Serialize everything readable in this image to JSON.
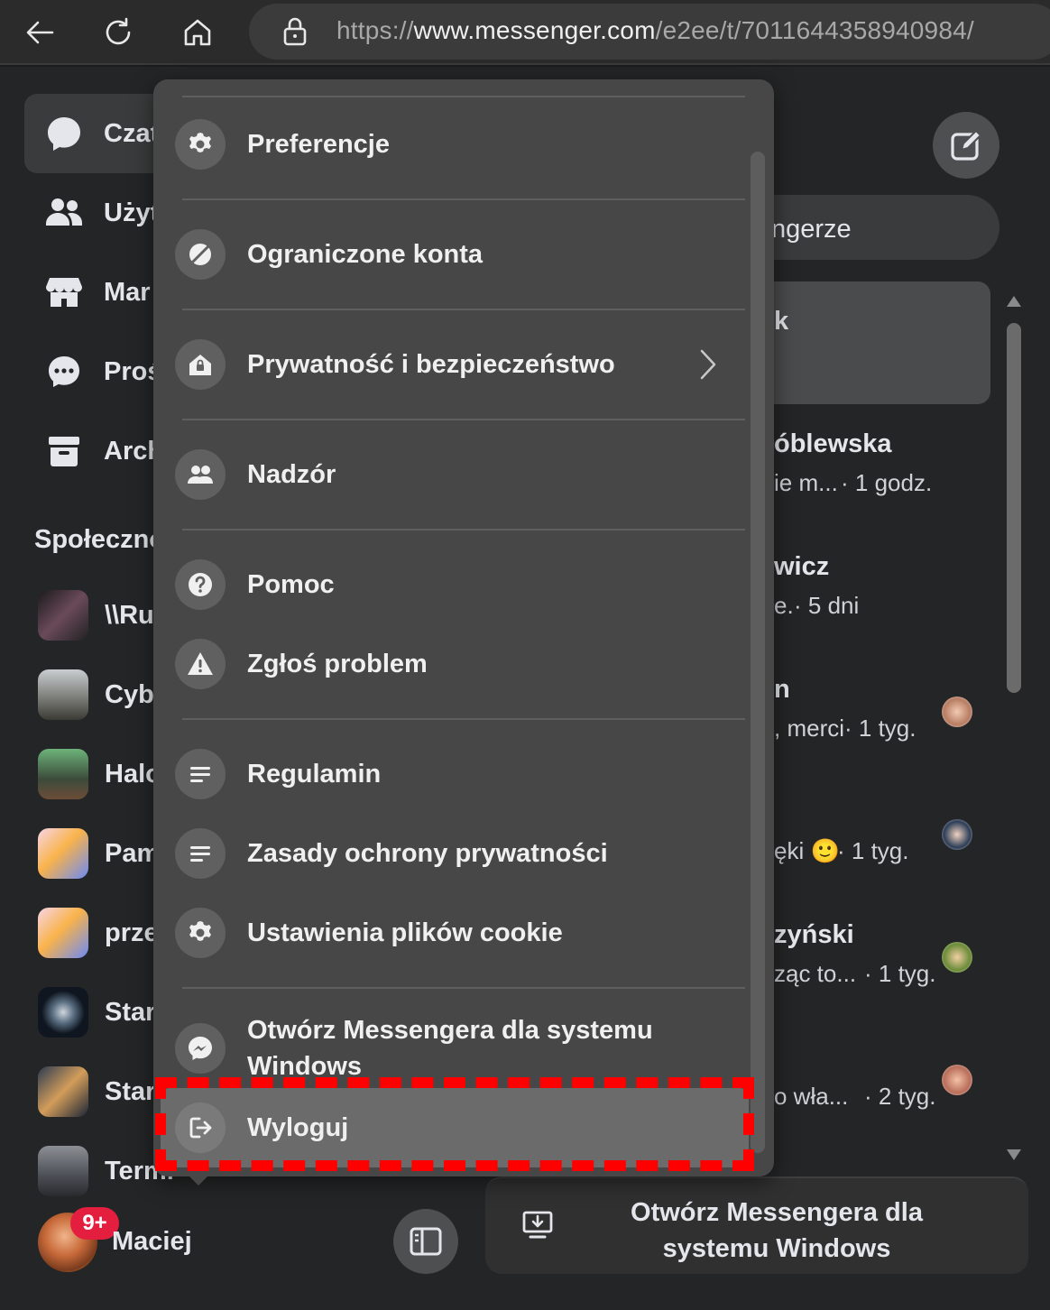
{
  "browser": {
    "url_prefix": "https://",
    "url_domain": "www.messenger.com",
    "url_path": "/e2ee/t/7011644358940984/"
  },
  "nav": {
    "items": [
      {
        "label": "Czat"
      },
      {
        "label": "Użyt"
      },
      {
        "label": "Mar"
      },
      {
        "label": "Proś"
      },
      {
        "label": "Arch"
      }
    ],
    "section_title": "Społeczno",
    "communities": [
      {
        "label": "\\\\Ru"
      },
      {
        "label": "Cybe"
      },
      {
        "label": "Halo"
      },
      {
        "label": "Pam"
      },
      {
        "label": "prze"
      },
      {
        "label": "Star"
      },
      {
        "label": "Star"
      },
      {
        "label": "Termi"
      }
    ]
  },
  "user": {
    "name": "Maciej",
    "badge": "9+"
  },
  "chat_panel": {
    "search_text": "ngerze",
    "highlight_name": "k",
    "chats": [
      {
        "name": "óblewska",
        "preview": "ie m...",
        "time": "· 1 godz."
      },
      {
        "name": "wicz",
        "preview": "e.",
        "time": "· 5 dni"
      },
      {
        "name": "n",
        "preview": ", merci",
        "time": "· 1 tyg."
      },
      {
        "name": "",
        "preview": "ęki 🙂",
        "time": "· 1 tyg."
      },
      {
        "name": "zyński",
        "preview": "ząc to...",
        "time": "· 1 tyg."
      },
      {
        "name": "",
        "preview": "o wła...",
        "time": "· 2 tyg."
      }
    ],
    "open_app_label": "Otwórz Messengera dla systemu Windows"
  },
  "menu": {
    "items": [
      {
        "label": "Preferencje",
        "icon": "gear-icon"
      },
      {
        "label": "Ograniczone konta",
        "icon": "restricted-icon"
      },
      {
        "label": "Prywatność i bezpieczeństwo",
        "icon": "privacy-home-icon"
      },
      {
        "label": "Nadzór",
        "icon": "supervision-icon"
      },
      {
        "label": "Pomoc",
        "icon": "help-icon"
      },
      {
        "label": "Zgłoś problem",
        "icon": "warning-icon"
      },
      {
        "label": "Regulamin",
        "icon": "document-lines-icon"
      },
      {
        "label": "Zasady ochrony prywatności",
        "icon": "document-lines-icon"
      },
      {
        "label": "Ustawienia plików cookie",
        "icon": "gear-icon"
      },
      {
        "label": "Otwórz Messengera dla systemu Windows",
        "icon": "messenger-icon"
      },
      {
        "label": "Wyloguj",
        "icon": "logout-icon"
      }
    ]
  },
  "colors": {
    "annotation": "#ff0000",
    "badge": "#e41e3f",
    "menu_bg": "#474747",
    "menu_highlight": "#6b6b6b"
  }
}
